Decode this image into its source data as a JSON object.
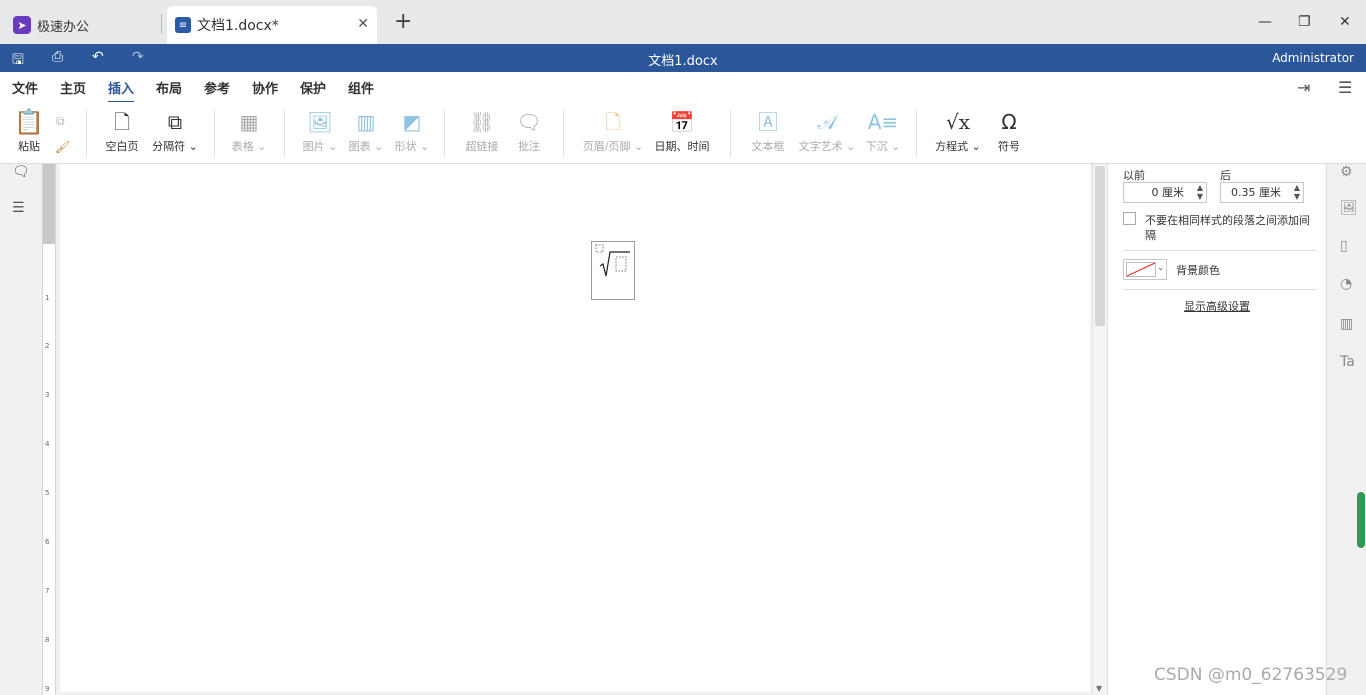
{
  "tabs": {
    "home_label": "极速办公",
    "doc_label": "文档1.docx*"
  },
  "titlebar": {
    "title": "文档1.docx",
    "user": "Administrator"
  },
  "menu": {
    "file": "文件",
    "home": "主页",
    "insert": "插入",
    "layout": "布局",
    "references": "参考",
    "collaborate": "协作",
    "protect": "保护",
    "plugins": "组件"
  },
  "ribbon": {
    "paste": "粘贴",
    "blank_page": "空白页",
    "page_break": "分隔符",
    "table": "表格",
    "image": "图片",
    "chart": "图表",
    "shape": "形状",
    "hyperlink": "超链接",
    "comment": "批注",
    "header_footer": "页眉/页脚",
    "date_time": "日期、时间",
    "textbox": "文本框",
    "textart": "文字艺术",
    "dropcap": "下沉",
    "equation": "方程式",
    "symbol": "符号"
  },
  "panel": {
    "before_label": "以前",
    "after_label": "后",
    "before_value": "0 厘米",
    "after_value": "0.35 厘米",
    "no_space_label_1": "不要在相同样式的段落之间添加间",
    "no_space_label_2": "隔",
    "bg_color_label": "背景颜色",
    "advanced_link": "显示高级设置"
  },
  "ruler_numbers": [
    "1",
    "2",
    "3",
    "4",
    "5",
    "6",
    "7",
    "8",
    "9"
  ],
  "watermark": "CSDN @m0_62763529",
  "colors": {
    "accent": "#2b579a",
    "app_logo": "#6a3bc0",
    "scroll_indicator": "#2c9c54"
  }
}
